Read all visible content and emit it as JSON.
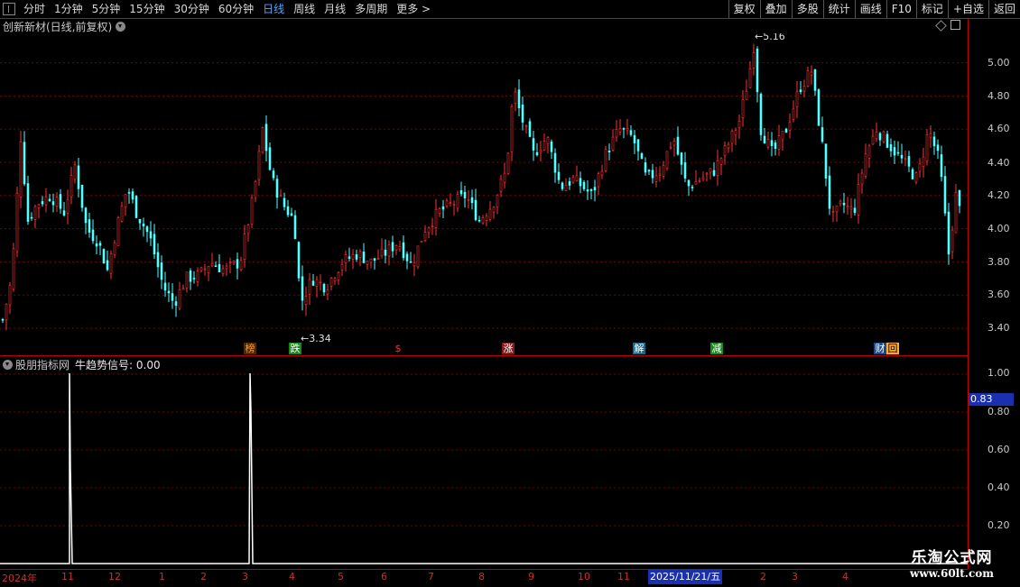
{
  "toolbar": {
    "left_items": [
      "分时",
      "1分钟",
      "5分钟",
      "15分钟",
      "30分钟",
      "60分钟",
      "日线",
      "周线",
      "月线",
      "多周期",
      "更多 >"
    ],
    "active_index": 6,
    "right_items": [
      "复权",
      "叠加",
      "多股",
      "统计",
      "画线",
      "F10",
      "标记",
      "+自选",
      "返回"
    ]
  },
  "main": {
    "title": "创新新材(日线,前复权)",
    "high_label": "5.16",
    "low_label": "3.34",
    "price_ticks": [
      "5.00",
      "4.80",
      "4.60",
      "4.40",
      "4.20",
      "4.00",
      "3.80",
      "3.60",
      "3.40"
    ],
    "markers": [
      {
        "text": "榜",
        "color": "#ff9933",
        "bg": "#4a2a00"
      },
      {
        "text": "跌",
        "color": "#ffffff",
        "bg": "#1a8a1a"
      },
      {
        "text": "$",
        "color": "#ff3030",
        "bg": "#000000"
      },
      {
        "text": "涨",
        "color": "#ffffff",
        "bg": "#8a1a1a"
      },
      {
        "text": "解",
        "color": "#ffffff",
        "bg": "#1a6a8a"
      },
      {
        "text": "减",
        "color": "#ffffff",
        "bg": "#1a8a1a"
      },
      {
        "text": "财",
        "color": "#ffffff",
        "bg": "#1a4a8a"
      },
      {
        "text": "回",
        "color": "#000000",
        "bg": "#ffaa33"
      }
    ]
  },
  "indicator": {
    "name": "股朋指标网",
    "label": "牛趋势信号: 0.00",
    "ticks": [
      "1.00",
      "0.80",
      "0.60",
      "0.40",
      "0.20"
    ],
    "cursor_value": "0.83"
  },
  "date_axis": {
    "labels": [
      "2024年",
      "11",
      "12",
      "1",
      "2",
      "3",
      "4",
      "5",
      "6",
      "7",
      "8",
      "9",
      "10",
      "11",
      "2",
      "3",
      "4"
    ],
    "active_date": "2025/11/21/五"
  },
  "watermark": {
    "line1": "乐淘公式网",
    "line2": "www.60lt.com"
  },
  "colors": {
    "up": "#ff3333",
    "down": "#54ffff",
    "grid": "#7a0000",
    "signal": "#ffffff"
  }
}
